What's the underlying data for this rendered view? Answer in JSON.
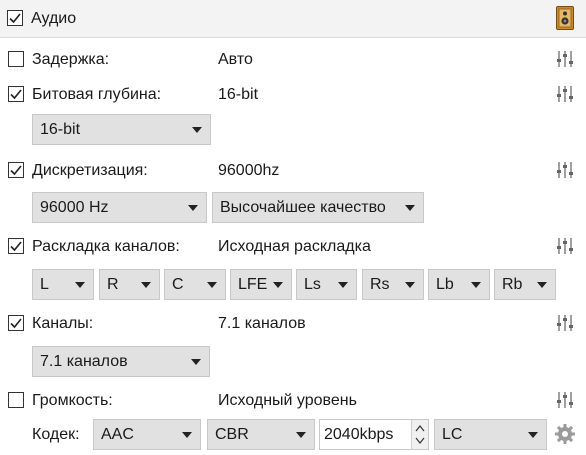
{
  "header": {
    "title": "Аудио",
    "checked": true,
    "icon": "speaker-icon"
  },
  "delay": {
    "label": "Задержка:",
    "value": "Авто",
    "checked": false
  },
  "bit_depth": {
    "label": "Битовая глубина:",
    "value": "16-bit",
    "checked": true,
    "select": "16-bit"
  },
  "sample_rate": {
    "label": "Дискретизация:",
    "value": "96000hz",
    "checked": true,
    "rate_select": "96000 Hz",
    "quality_select": "Высочайшее качество"
  },
  "channel_layout": {
    "label": "Раскладка каналов:",
    "value": "Исходная раскладка",
    "checked": true,
    "channels": [
      "L",
      "R",
      "C",
      "LFE",
      "Ls",
      "Rs",
      "Lb",
      "Rb"
    ]
  },
  "channels": {
    "label": "Каналы:",
    "value": "7.1 каналов",
    "checked": true,
    "select": "7.1 каналов"
  },
  "volume": {
    "label": "Громкость:",
    "value": "Исходный уровень",
    "checked": false
  },
  "codec": {
    "label": "Кодек:",
    "codec_select": "AAC",
    "mode_select": "CBR",
    "bitrate": "2040kbps",
    "profile_select": "LC"
  }
}
